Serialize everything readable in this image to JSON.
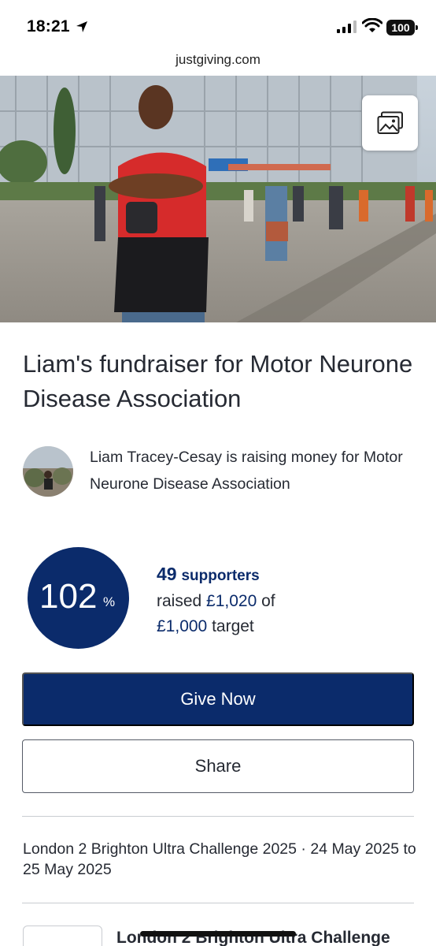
{
  "status_bar": {
    "time": "18:21",
    "battery": "100"
  },
  "browser": {
    "url": "justgiving.com"
  },
  "hero": {
    "gallery_icon": "image-gallery-icon"
  },
  "page": {
    "title": "Liam's fundraiser for Motor Neurone Disease Association"
  },
  "organiser": {
    "text": "Liam Tracey-Cesay is raising money for Motor Neurone Disease Association"
  },
  "progress": {
    "percent": "102",
    "unit": "%",
    "supporters_count": "49",
    "supporters_label": "supporters",
    "raised_prefix": "raised ",
    "raised_amount": "£1,020",
    "raised_suffix": " of",
    "target_amount": "£1,000",
    "target_suffix": " target"
  },
  "actions": {
    "give_label": "Give Now",
    "share_label": "Share"
  },
  "event": {
    "line": "London 2 Brighton Ultra Challenge 2025 · 24 May 2025 to 25 May 2025",
    "card_title": "London 2 Brighton Ultra Challenge"
  },
  "colors": {
    "brand_navy": "#0b2b6b",
    "text": "#262a33",
    "divider": "#c9ccd1"
  }
}
